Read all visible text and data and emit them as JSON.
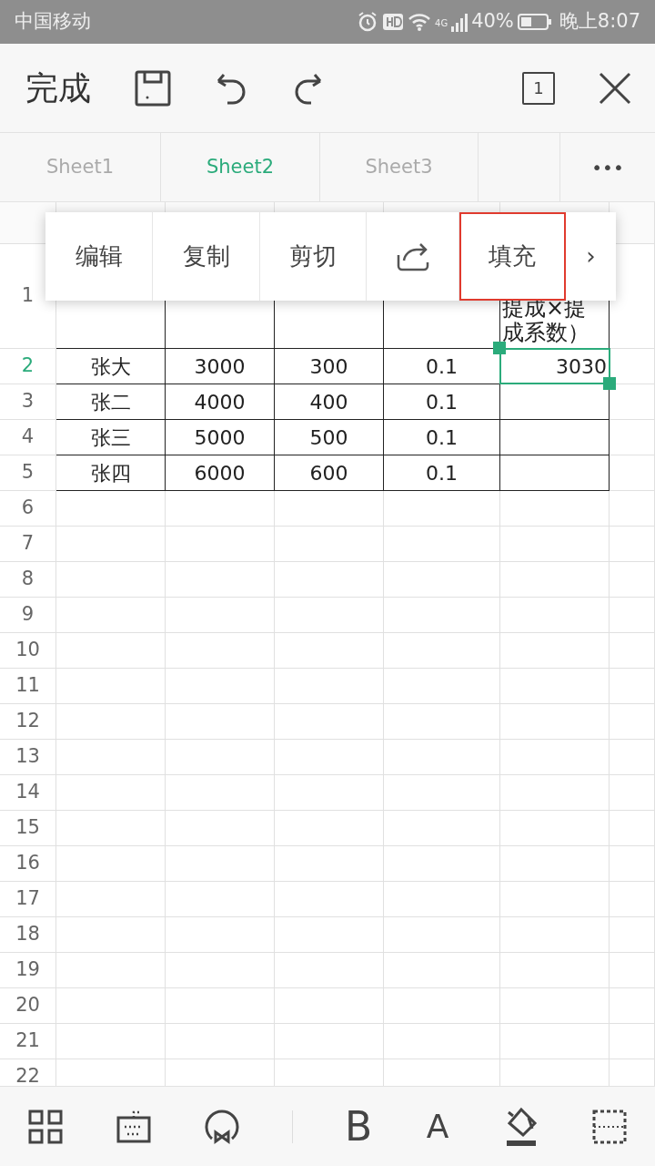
{
  "status_bar": {
    "carrier": "中国移动",
    "network": "4G",
    "battery": "40%",
    "time": "晚上8:07"
  },
  "toolbar": {
    "done": "完成",
    "sheet_count": "1"
  },
  "sheet_tabs": [
    {
      "label": "Sheet1",
      "selected": false
    },
    {
      "label": "Sheet2",
      "selected": true
    },
    {
      "label": "Sheet3",
      "selected": false
    }
  ],
  "more": "•••",
  "context_menu": [
    {
      "kind": "text",
      "label": "编辑",
      "highlighted": false
    },
    {
      "kind": "text",
      "label": "复制",
      "highlighted": false
    },
    {
      "kind": "text",
      "label": "剪切",
      "highlighted": false
    },
    {
      "kind": "share",
      "highlighted": false
    },
    {
      "kind": "text",
      "label": "填充",
      "highlighted": true
    },
    {
      "kind": "next",
      "label": "›",
      "highlighted": false
    }
  ],
  "grid": {
    "rows": [
      {
        "label": "1",
        "selected": false,
        "cells": [
          "",
          "",
          "",
          "",
          "提成×提成系数）"
        ]
      },
      {
        "label": "2",
        "selected": true,
        "cells": [
          "张大",
          "3000",
          "300",
          "0.1",
          {
            "text": "3030",
            "selected": true
          }
        ]
      },
      {
        "label": "3",
        "selected": false,
        "cells": [
          "张二",
          "4000",
          "400",
          "0.1",
          ""
        ]
      },
      {
        "label": "4",
        "selected": false,
        "cells": [
          "张三",
          "5000",
          "500",
          "0.1",
          ""
        ]
      },
      {
        "label": "5",
        "selected": false,
        "cells": [
          "张四",
          "6000",
          "600",
          "0.1",
          ""
        ]
      },
      {
        "label": "6",
        "selected": false
      },
      {
        "label": "7",
        "selected": false
      },
      {
        "label": "8",
        "selected": false
      },
      {
        "label": "9",
        "selected": false
      },
      {
        "label": "10",
        "selected": false
      },
      {
        "label": "11",
        "selected": false
      },
      {
        "label": "12",
        "selected": false
      },
      {
        "label": "13",
        "selected": false
      },
      {
        "label": "14",
        "selected": false
      },
      {
        "label": "15",
        "selected": false
      },
      {
        "label": "16",
        "selected": false
      },
      {
        "label": "17",
        "selected": false
      },
      {
        "label": "18",
        "selected": false
      },
      {
        "label": "19",
        "selected": false
      },
      {
        "label": "20",
        "selected": false
      },
      {
        "label": "21",
        "selected": false
      },
      {
        "label": "22",
        "selected": false
      }
    ]
  },
  "bottom_toolbar": {
    "bold": "B",
    "font_color": "A"
  }
}
